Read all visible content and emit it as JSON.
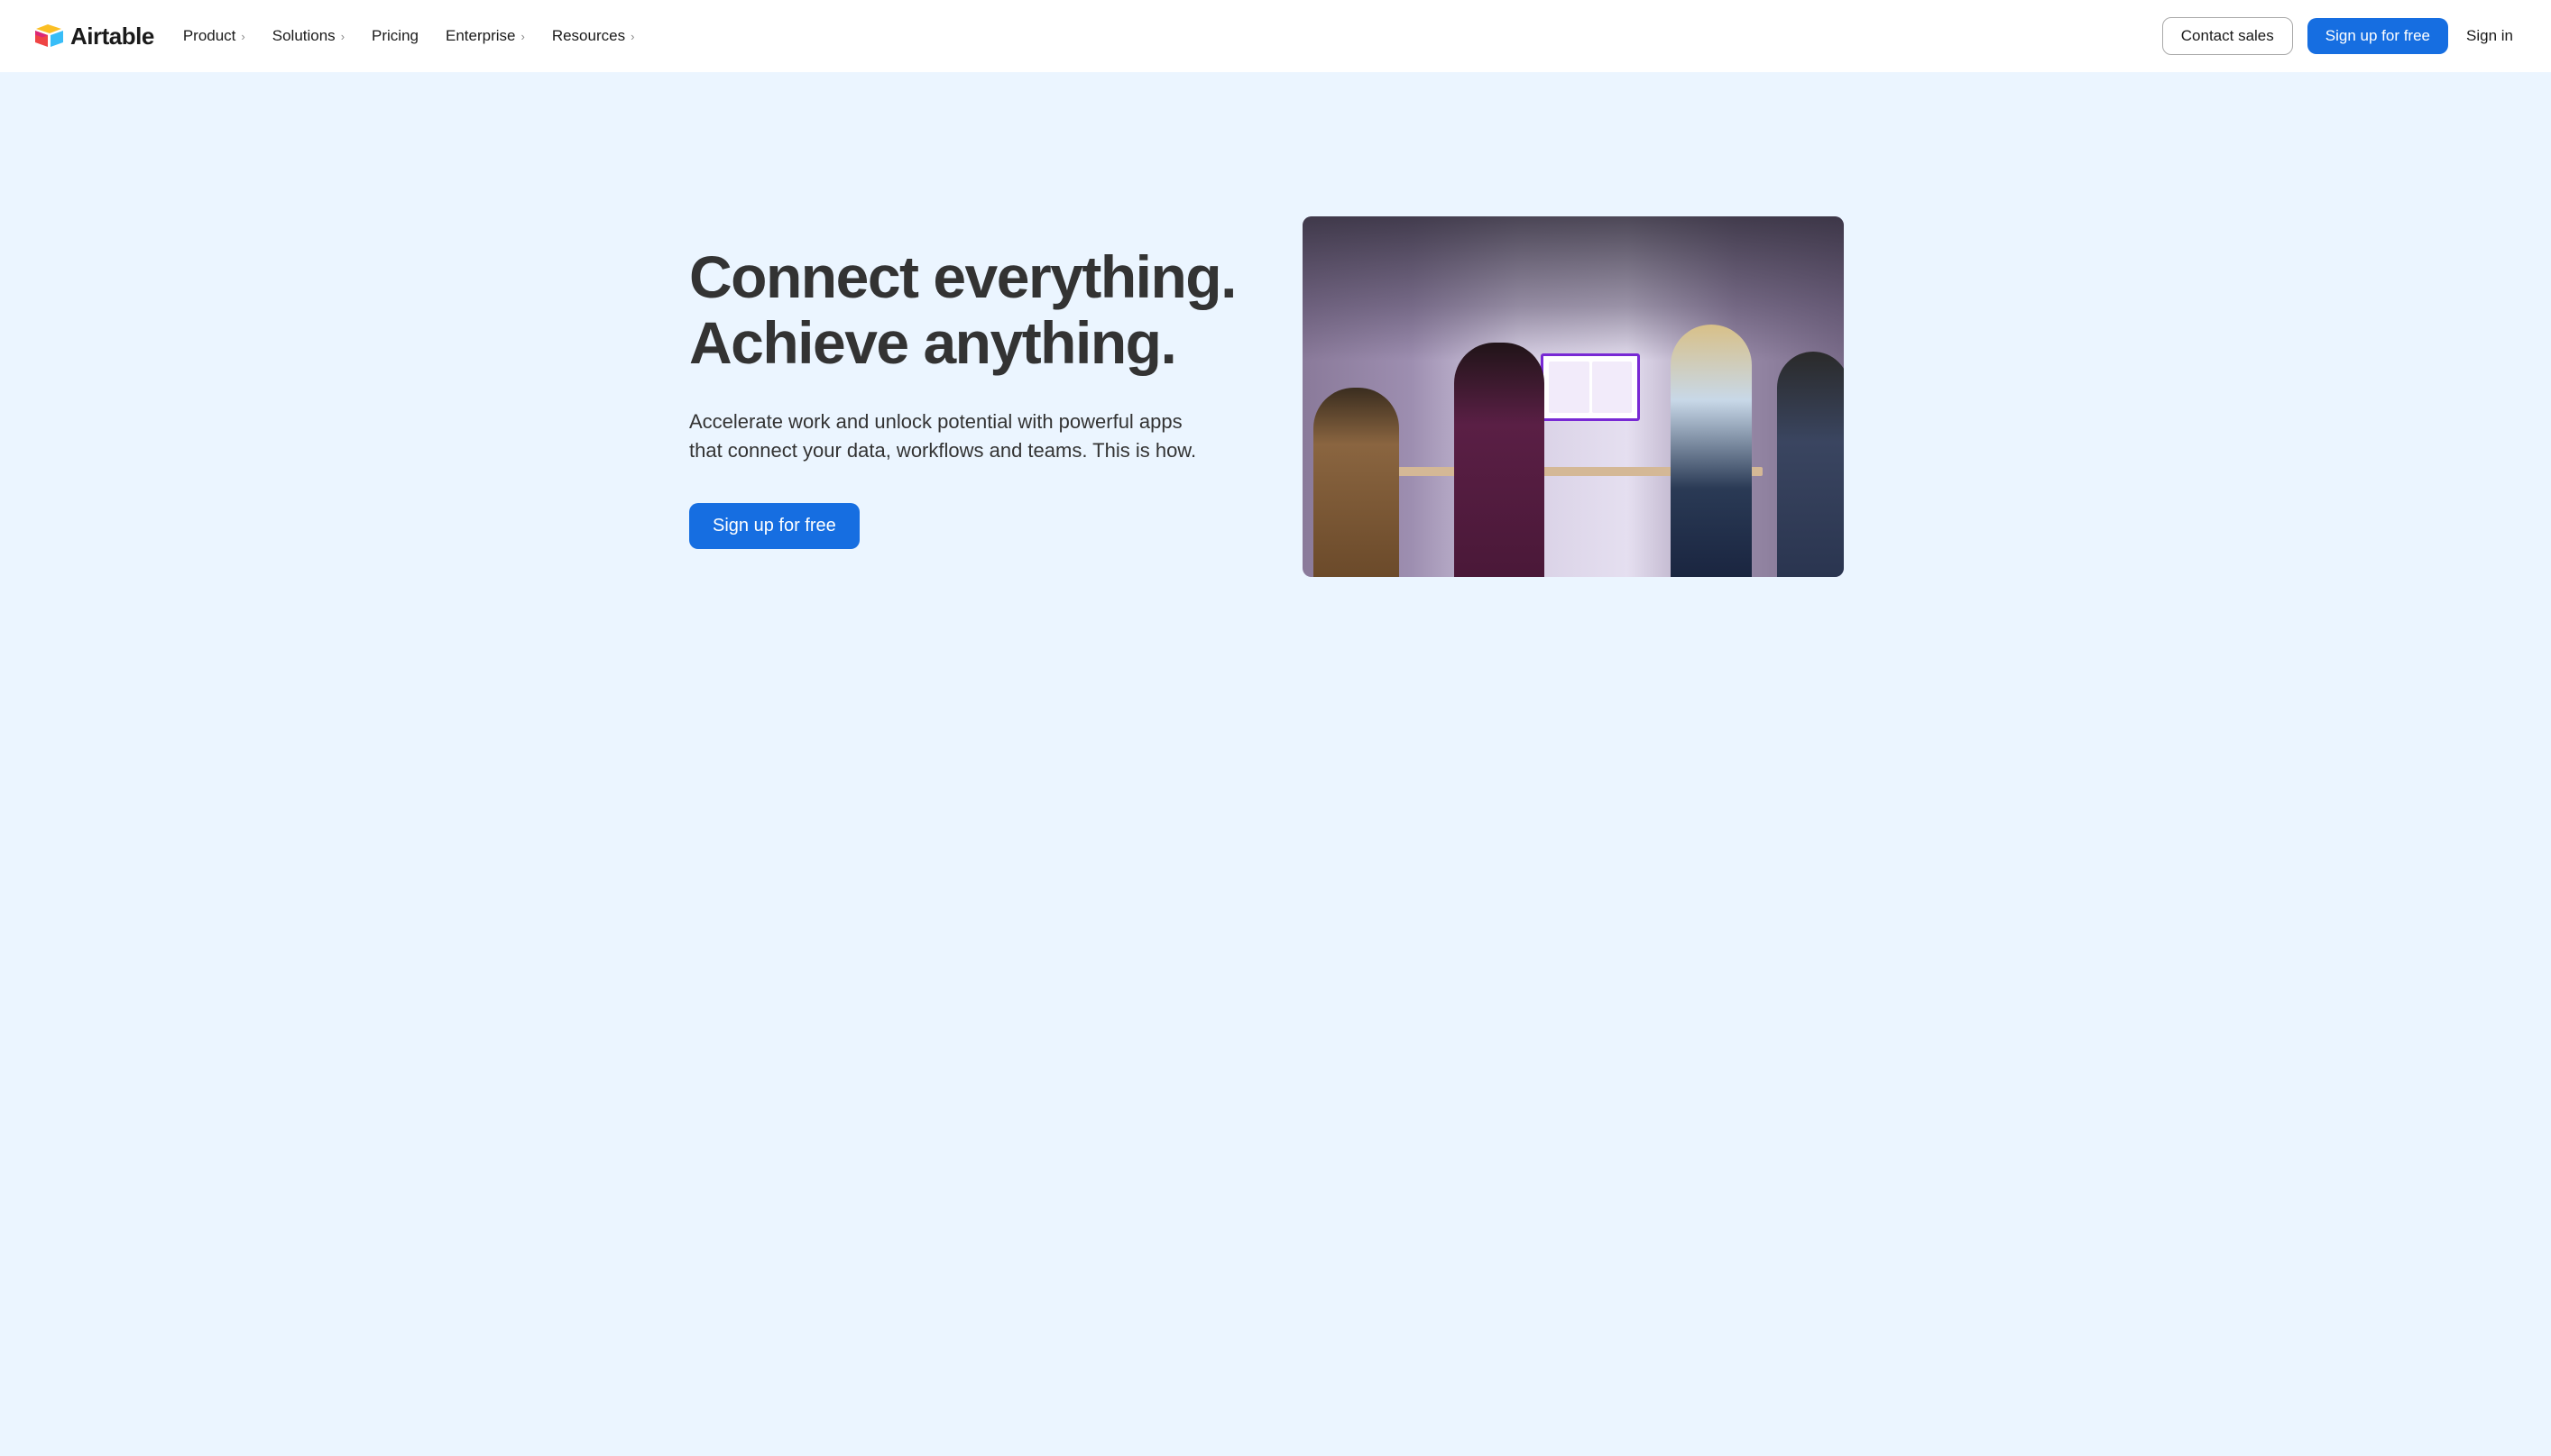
{
  "brand": {
    "name": "Airtable"
  },
  "nav": {
    "items": [
      {
        "label": "Product",
        "hasDropdown": true
      },
      {
        "label": "Solutions",
        "hasDropdown": true
      },
      {
        "label": "Pricing",
        "hasDropdown": false
      },
      {
        "label": "Enterprise",
        "hasDropdown": true
      },
      {
        "label": "Resources",
        "hasDropdown": true
      }
    ],
    "contact": "Contact sales",
    "signup": "Sign up for free",
    "signin": "Sign in"
  },
  "hero": {
    "title": "Connect everything. Achieve anything.",
    "subtitle": "Accelerate work and unlock potential with powerful apps that connect your data, workflows and teams. This is how.",
    "cta": "Sign up for free"
  },
  "colors": {
    "primary": "#166ee1",
    "heroBg": "#ebf5ff",
    "text": "#333333"
  }
}
